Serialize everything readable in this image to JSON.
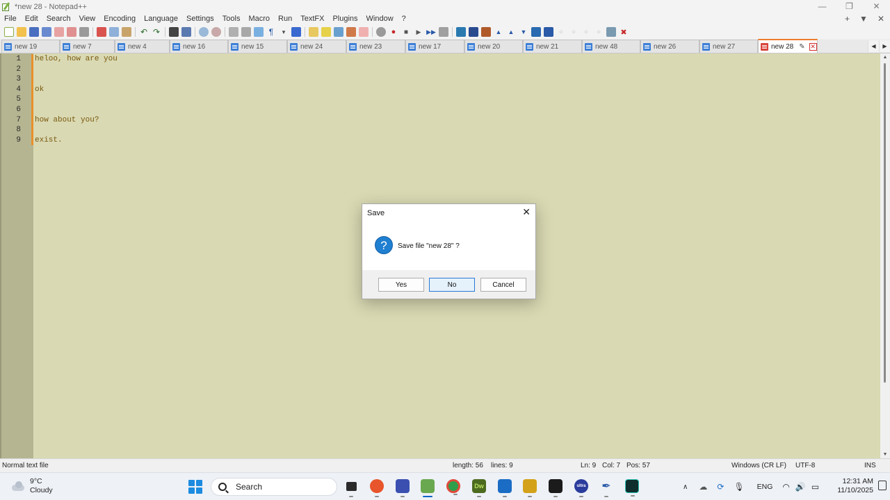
{
  "window": {
    "title": "*new 28 - Notepad++",
    "controls": [
      "—",
      "❐",
      "✕"
    ]
  },
  "menu": {
    "items": [
      "File",
      "Edit",
      "Search",
      "View",
      "Encoding",
      "Language",
      "Settings",
      "Tools",
      "Macro",
      "Run",
      "TextFX",
      "Plugins",
      "Window",
      "?"
    ],
    "right": [
      "+",
      "▼",
      "✕"
    ]
  },
  "tabs": [
    {
      "label": "new 19"
    },
    {
      "label": "new 7"
    },
    {
      "label": "new 4"
    },
    {
      "label": "new 16"
    },
    {
      "label": "new 15"
    },
    {
      "label": "new 24"
    },
    {
      "label": "new 23"
    },
    {
      "label": "new 17"
    },
    {
      "label": "new 20"
    },
    {
      "label": "new 21"
    },
    {
      "label": "new 48"
    },
    {
      "label": "new 26"
    },
    {
      "label": "new 27"
    },
    {
      "label": "new 28",
      "active": true
    }
  ],
  "editor": {
    "lines": [
      {
        "n": "1",
        "text": "heloo, how are you"
      },
      {
        "n": "2",
        "text": ""
      },
      {
        "n": "3",
        "text": ""
      },
      {
        "n": "4",
        "text": "ok"
      },
      {
        "n": "5",
        "text": ""
      },
      {
        "n": "6",
        "text": ""
      },
      {
        "n": "7",
        "text": "how about you?"
      },
      {
        "n": "8",
        "text": ""
      },
      {
        "n": "9",
        "text": "exist."
      }
    ]
  },
  "status": {
    "file_type": "Normal text file",
    "length": "length: 56",
    "lines": "lines: 9",
    "ln": "Ln: 9",
    "col": "Col: 7",
    "pos": "Pos: 57",
    "eol": "Windows (CR LF)",
    "encoding": "UTF-8",
    "mode": "INS"
  },
  "dialog": {
    "title": "Save",
    "message": "Save file \"new 28\" ?",
    "yes": "Yes",
    "no": "No",
    "cancel": "Cancel",
    "close": "✕",
    "icon": "?"
  },
  "taskbar": {
    "temperature": "9°C",
    "condition": "Cloudy",
    "search_placeholder": "Search",
    "language": "ENG",
    "time": "12:31 AM",
    "date": "11/10/2025",
    "apps": [
      {
        "name": "file-manager-icon",
        "color": "#2b2b2b",
        "label": ""
      },
      {
        "name": "firefox-icon",
        "color": "#e8542b",
        "label": ""
      },
      {
        "name": "save-app-icon",
        "color": "#3a4fb0",
        "label": ""
      },
      {
        "name": "notepad-plus-plus-icon",
        "color": "#6aa84f",
        "label": ""
      },
      {
        "name": "chrome-icon",
        "color": "#2f9e4a",
        "label": ""
      },
      {
        "name": "dreamweaver-icon",
        "color": "#4d6b1f",
        "label": "Dw"
      },
      {
        "name": "store-icon",
        "color": "#1a6cc4",
        "label": ""
      },
      {
        "name": "pen-tool-icon",
        "color": "#d4a21a",
        "label": ""
      },
      {
        "name": "terminal-icon",
        "color": "#1b1b1b",
        "label": ""
      },
      {
        "name": "ultra-icon",
        "color": "#2a3c9c",
        "label": "ultra"
      },
      {
        "name": "feather-icon",
        "color": "#2a5aa8",
        "label": ""
      },
      {
        "name": "dev-terminal-icon",
        "color": "#0f2e2e",
        "label": ""
      }
    ]
  }
}
